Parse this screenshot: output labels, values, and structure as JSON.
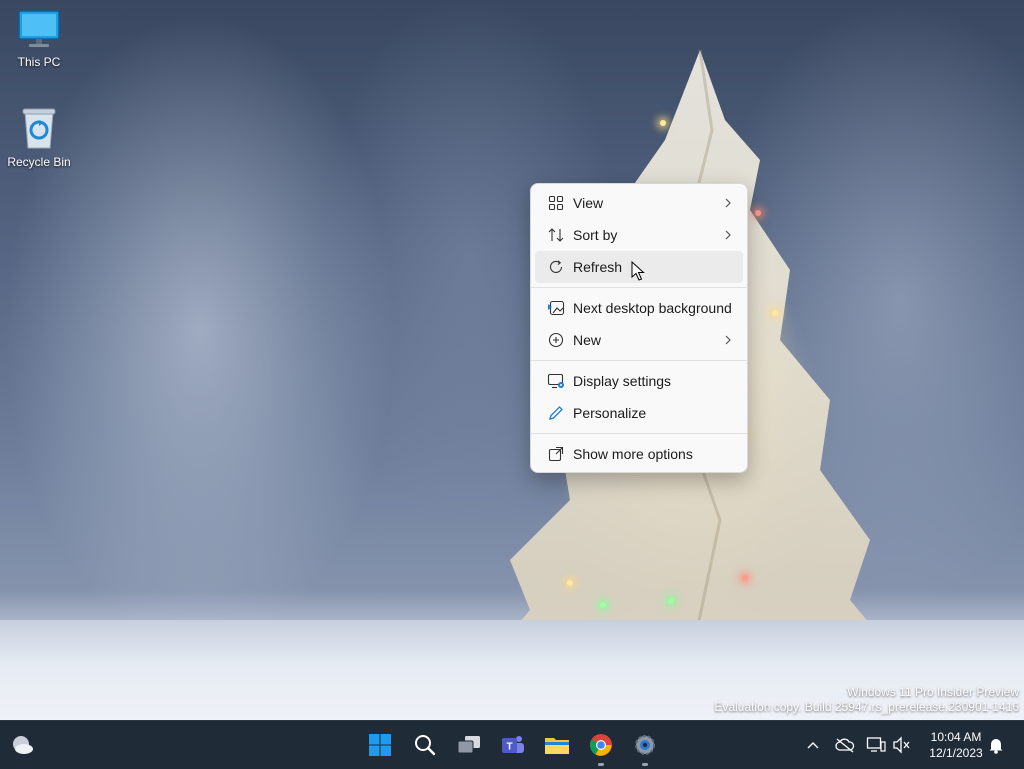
{
  "desktop": {
    "icons": [
      {
        "label": "This PC",
        "icon": "monitor-icon"
      },
      {
        "label": "Recycle Bin",
        "icon": "recycle-bin-icon"
      }
    ],
    "watermark": {
      "line1": "Windows 11 Pro Insider Preview",
      "line2": "Evaluation copy. Build 25947.rs_prerelease.230901-1416"
    }
  },
  "context_menu": {
    "items": [
      {
        "label": "View",
        "icon": "grid-view-icon",
        "submenu": true
      },
      {
        "label": "Sort by",
        "icon": "sort-icon",
        "submenu": true
      },
      {
        "label": "Refresh",
        "icon": "refresh-icon",
        "submenu": false,
        "hovered": true
      },
      {
        "label": "Next desktop background",
        "icon": "next-background-icon",
        "submenu": false
      },
      {
        "label": "New",
        "icon": "new-plus-icon",
        "submenu": true
      },
      {
        "label": "Display settings",
        "icon": "display-settings-icon",
        "submenu": false
      },
      {
        "label": "Personalize",
        "icon": "pen-icon",
        "submenu": false
      },
      {
        "label": "Show more options",
        "icon": "show-more-options-icon",
        "submenu": false
      }
    ]
  },
  "taskbar": {
    "apps": [
      {
        "name": "Start",
        "icon": "windows-start-icon"
      },
      {
        "name": "Search",
        "icon": "search-icon"
      },
      {
        "name": "Task View",
        "icon": "task-view-icon"
      },
      {
        "name": "Teams",
        "icon": "teams-icon"
      },
      {
        "name": "File Explorer",
        "icon": "file-explorer-icon"
      },
      {
        "name": "Chrome",
        "icon": "chrome-icon",
        "running": true
      },
      {
        "name": "Settings",
        "icon": "settings-gear-icon",
        "running": true
      }
    ],
    "clock": {
      "time": "10:04 AM",
      "date": "12/1/2023"
    },
    "colors": {
      "taskbar_bg": "#202b38",
      "start_blue": "#1e9bf0"
    }
  }
}
